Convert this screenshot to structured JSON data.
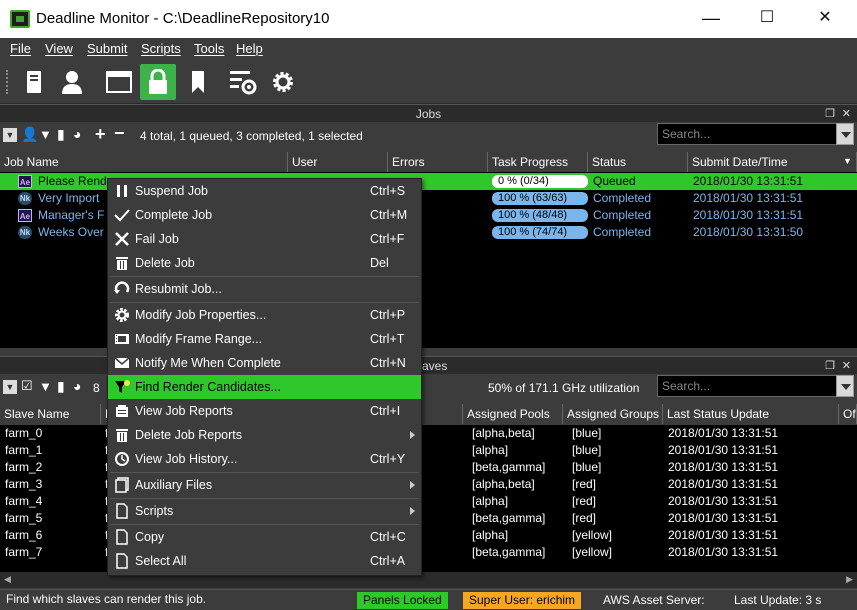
{
  "window": {
    "title": "Deadline Monitor  -  C:\\DeadlineRepository10",
    "minimize": "—",
    "maximize": "☐",
    "close": "✕"
  },
  "menu": [
    "File",
    "View",
    "Submit",
    "Scripts",
    "Tools",
    "Help"
  ],
  "toolbar": {
    "icons": [
      "slave-list-icon",
      "user-icon",
      "window-icon",
      "lock-icon",
      "bookmark-icon",
      "settings-list-icon",
      "gear-icon"
    ],
    "active": "lock-icon"
  },
  "jobs_panel": {
    "title": "Jobs",
    "summary": "4 total, 1 queued, 3 completed, 1 selected",
    "search_placeholder": "Search...",
    "columns": [
      "Job Name",
      "User",
      "Errors",
      "Task Progress",
      "Status",
      "Submit Date/Time"
    ],
    "rows": [
      {
        "icon": "Ae",
        "name": "Please Rend",
        "progress_text": "0 %   (0/34)",
        "progress": 0,
        "status": "Queued",
        "date": "2018/01/30 13:31:51",
        "selected": true
      },
      {
        "icon": "Nk",
        "name": "Very Import",
        "progress_text": "100 %   (63/63)",
        "progress": 100,
        "status": "Completed",
        "date": "2018/01/30 13:31:51",
        "selected": false
      },
      {
        "icon": "Ae",
        "name": "Manager's F",
        "progress_text": "100 %   (48/48)",
        "progress": 100,
        "status": "Completed",
        "date": "2018/01/30 13:31:51",
        "selected": false
      },
      {
        "icon": "Nk",
        "name": "Weeks Over",
        "progress_text": "100 %   (74/74)",
        "progress": 100,
        "status": "Completed",
        "date": "2018/01/30 13:31:50",
        "selected": false
      }
    ]
  },
  "slaves_panel": {
    "title": "aves",
    "count_fragment": "8",
    "utilization": "50% of 171.1 GHz utilization",
    "search_placeholder": "Search...",
    "columns": [
      "Slave Name",
      "N",
      "Assigned Pools",
      "Assigned Groups",
      "Last Status Update",
      "Of"
    ],
    "rows": [
      {
        "name": "farm_0",
        "n": "f",
        "pools": "[alpha,beta]",
        "groups": "[blue]",
        "updated": "2018/01/30 13:31:51"
      },
      {
        "name": "farm_1",
        "n": "f",
        "pools": "[alpha]",
        "groups": "[blue]",
        "updated": "2018/01/30 13:31:51"
      },
      {
        "name": "farm_2",
        "n": "f",
        "pools": "[beta,gamma]",
        "groups": "[blue]",
        "updated": "2018/01/30 13:31:51"
      },
      {
        "name": "farm_3",
        "n": "f",
        "pools": "[alpha,beta]",
        "groups": "[red]",
        "updated": "2018/01/30 13:31:51"
      },
      {
        "name": "farm_4",
        "n": "f",
        "pools": "[alpha]",
        "groups": "[red]",
        "updated": "2018/01/30 13:31:51"
      },
      {
        "name": "farm_5",
        "n": "f",
        "pools": "[beta,gamma]",
        "groups": "[red]",
        "updated": "2018/01/30 13:31:51"
      },
      {
        "name": "farm_6",
        "n": "f",
        "pools": "[alpha]",
        "groups": "[yellow]",
        "updated": "2018/01/30 13:31:51"
      },
      {
        "name": "farm_7",
        "n": "f",
        "pools": "[beta,gamma]",
        "groups": "[yellow]",
        "updated": "2018/01/30 13:31:51"
      }
    ]
  },
  "context_menu": [
    {
      "icon": "pause-icon",
      "label": "Suspend Job",
      "shortcut": "Ctrl+S"
    },
    {
      "icon": "checkmark-icon",
      "label": "Complete Job",
      "shortcut": "Ctrl+M"
    },
    {
      "icon": "x-icon",
      "label": "Fail Job",
      "shortcut": "Ctrl+F"
    },
    {
      "icon": "trash-icon",
      "label": "Delete Job",
      "shortcut": "Del"
    },
    {
      "sep": true
    },
    {
      "icon": "resubmit-icon",
      "label": "Resubmit Job...",
      "shortcut": ""
    },
    {
      "sep": true
    },
    {
      "icon": "gear-icon",
      "label": "Modify Job Properties...",
      "shortcut": "Ctrl+P"
    },
    {
      "icon": "film-icon",
      "label": "Modify Frame Range...",
      "shortcut": "Ctrl+T"
    },
    {
      "icon": "envelope-icon",
      "label": "Notify Me When Complete",
      "shortcut": "Ctrl+N"
    },
    {
      "icon": "filter-icon",
      "label": "Find Render Candidates...",
      "shortcut": "",
      "highlighted": true
    },
    {
      "icon": "reports-icon",
      "label": "View Job Reports",
      "shortcut": "Ctrl+I"
    },
    {
      "icon": "trash-icon",
      "label": "Delete Job Reports",
      "shortcut": "",
      "submenu": true
    },
    {
      "icon": "history-icon",
      "label": "View Job History...",
      "shortcut": "Ctrl+Y"
    },
    {
      "sep": true
    },
    {
      "icon": "files-icon",
      "label": "Auxiliary Files",
      "shortcut": "",
      "submenu": true
    },
    {
      "sep": true
    },
    {
      "icon": "script-icon",
      "label": "Scripts",
      "shortcut": "",
      "submenu": true
    },
    {
      "sep": true
    },
    {
      "icon": "copy-icon",
      "label": "Copy",
      "shortcut": "Ctrl+C"
    },
    {
      "icon": "select-all-icon",
      "label": "Select All",
      "shortcut": "Ctrl+A"
    }
  ],
  "statusbar": {
    "hint": "Find which slaves can render this job.",
    "panels_locked": "Panels Locked",
    "super_user": "Super User: erichim",
    "aws": "AWS Asset Server:",
    "last_update": "Last Update: 3 s"
  },
  "colors": {
    "green": "#2fc82a",
    "blue_text": "#7ab6ec",
    "progress_blue": "#7ab6ec",
    "orange": "#f5a623"
  }
}
